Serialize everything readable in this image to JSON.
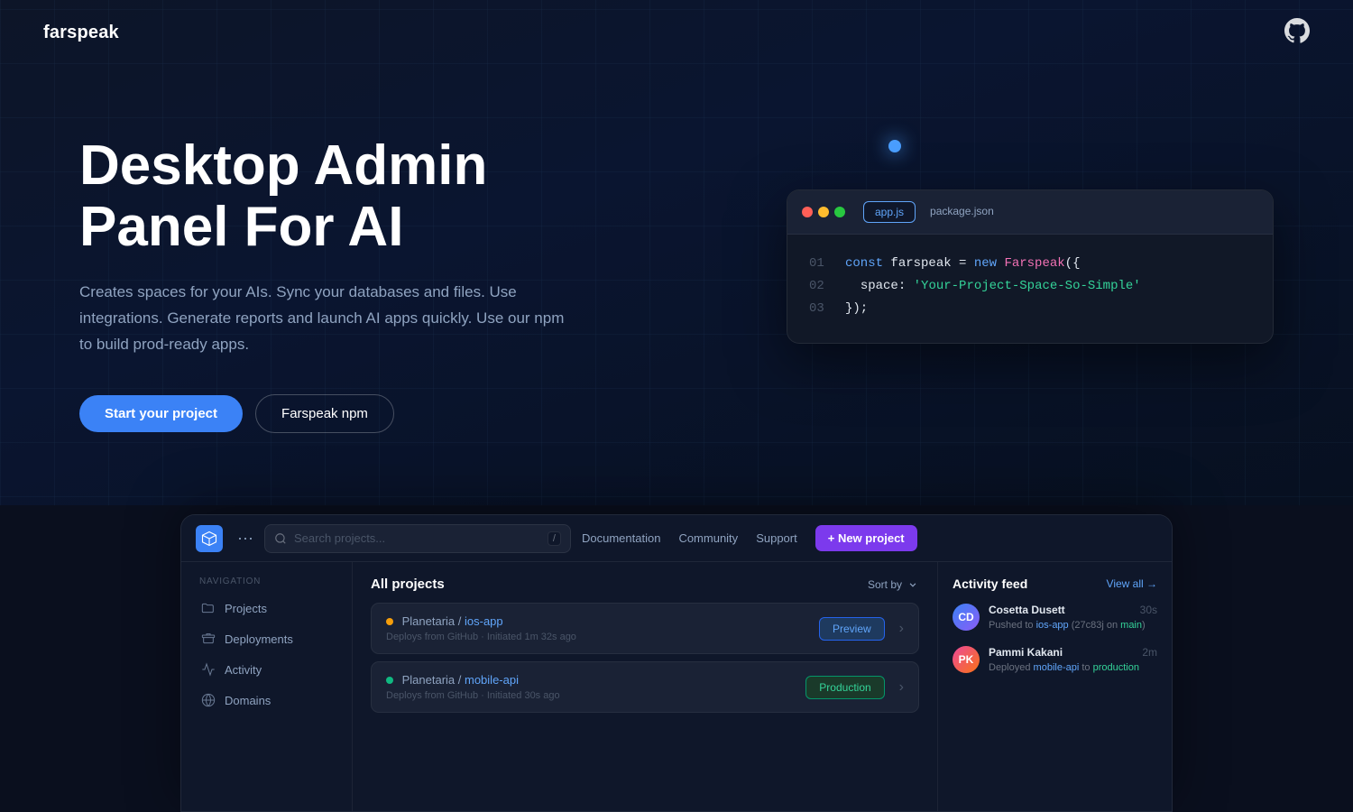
{
  "nav": {
    "logo": "farspeak",
    "github_icon": "github-icon"
  },
  "hero": {
    "title": "Desktop Admin Panel For AI",
    "subtitle": "Creates spaces for your AIs. Sync your databases and files. Use integrations. Generate reports and launch AI apps quickly. Use our npm to build prod-ready apps.",
    "btn_primary": "Start your project",
    "btn_secondary": "Farspeak npm"
  },
  "code_card": {
    "tab_active": "app.js",
    "tab_inactive": "package.json",
    "line1_num": "01",
    "line1_code": "const farspeak = new Farspeak({",
    "line2_num": "02",
    "line2_code": "  space: 'Your-Project-Space-So-Simple'",
    "line3_num": "03",
    "line3_code": "});"
  },
  "dashboard": {
    "search_placeholder": "Search projects...",
    "search_shortcut": "/",
    "nav_links": [
      "Documentation",
      "Community",
      "Support"
    ],
    "btn_new_project": "+ New project",
    "sidebar": {
      "nav_label": "Navigation",
      "items": [
        {
          "label": "Projects",
          "icon": "folder-icon"
        },
        {
          "label": "Deployments",
          "icon": "deployments-icon"
        },
        {
          "label": "Activity",
          "icon": "activity-icon"
        },
        {
          "label": "Domains",
          "icon": "domains-icon"
        }
      ]
    },
    "main": {
      "title": "All projects",
      "sort_label": "Sort by",
      "projects": [
        {
          "org": "Planetaria",
          "separator": "/",
          "name": "ios-app",
          "meta": "Deploys from GitHub · Initiated 1m 32s ago",
          "status": "yellow",
          "badge": "Preview"
        },
        {
          "org": "Planetaria",
          "separator": "/",
          "name": "mobile-api",
          "meta": "Deploys from GitHub · Initiated 30s ago",
          "status": "green",
          "badge": "Production"
        }
      ]
    },
    "activity_feed": {
      "title": "Activity feed",
      "view_all": "View all →",
      "items": [
        {
          "name": "Cosetta Dusett",
          "time": "30s",
          "desc": "Pushed to ios-app (27c83j on ",
          "branch": "main",
          "desc_end": ")",
          "avatar_initials": "CD",
          "avatar_class": "avatar-blue"
        },
        {
          "name": "Pammi Kakani",
          "time": "2m",
          "desc": "Deployed mobile-api to ",
          "branch": "production",
          "desc_end": "",
          "avatar_initials": "PK",
          "avatar_class": "avatar-pink"
        }
      ]
    }
  }
}
